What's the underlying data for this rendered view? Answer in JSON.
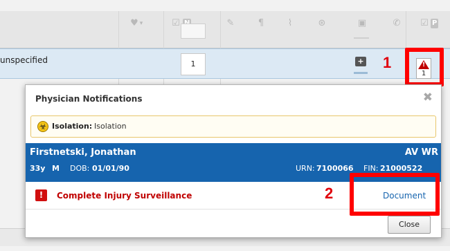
{
  "grid": {
    "header_icons": [
      "heart-icon",
      "checkbox-n-icon",
      "paperclip-icon",
      "lab-icon",
      "vitals-icon",
      "radiation-icon",
      "case-icon",
      "phone-icon",
      "checkbox-p-icon"
    ],
    "header_n_label": "N",
    "header_p_label": "P",
    "selected_row": {
      "diagnosis": "unspecified",
      "cell_value": "1",
      "warning_count": "1"
    }
  },
  "callouts": {
    "one": "1",
    "two": "2",
    "highlight_color": "#ff0000"
  },
  "modal": {
    "title": "Physician Notifications",
    "isolation": {
      "label": "Isolation:",
      "value": "Isolation"
    },
    "patient": {
      "name": "Firstnetski, Jonathan",
      "location": "AV WR",
      "age": "33y",
      "sex": "M",
      "dob_label": "DOB:",
      "dob": "01/01/90",
      "urn_label": "URN:",
      "urn": "7100066",
      "fin_label": "FIN:",
      "fin": "21000522"
    },
    "task": {
      "label": "Complete Injury Surveillance",
      "action": "Document"
    },
    "close_label": "Close"
  },
  "colors": {
    "banner": "#1664ae",
    "task_red": "#c00000",
    "isolation_border": "#e8c66b"
  }
}
